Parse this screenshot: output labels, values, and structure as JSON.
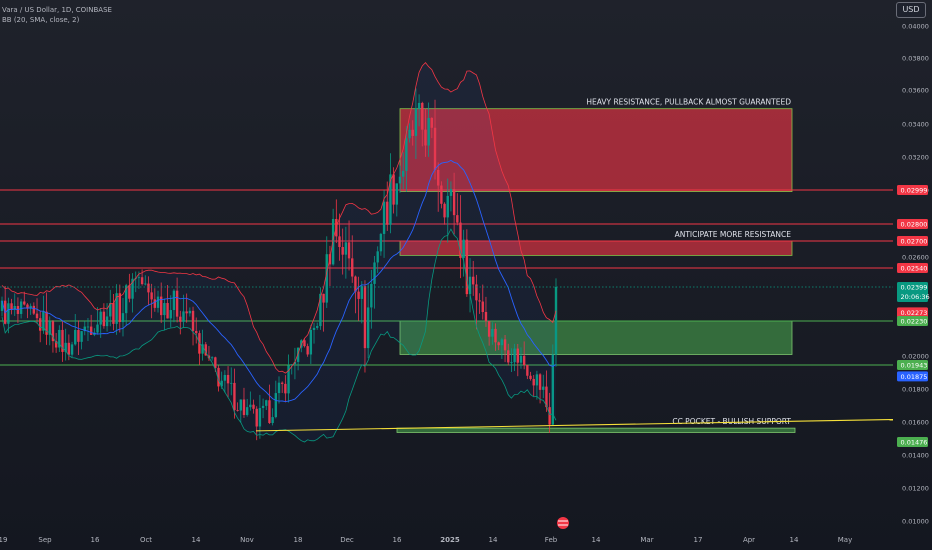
{
  "legend": {
    "symbol": "Vara / US Dollar, 1D, COINBASE",
    "indicator": "BB (20, SMA, close, 2)"
  },
  "currency_button": "USD",
  "chart_data": {
    "type": "candlestick",
    "y_axis": {
      "ylim": [
        0.0098,
        0.0406
      ],
      "ticks": [
        0.04,
        0.038,
        0.036,
        0.034,
        0.032,
        0.03,
        0.026,
        0.02,
        0.018,
        0.016,
        0.014,
        0.012,
        0.01
      ],
      "tick_labels": [
        "0.04000",
        "0.03800",
        "0.03600",
        "0.03400",
        "0.03200",
        "0.03000",
        "0.02600",
        "0.02000",
        "0.01800",
        "0.01600",
        "0.01400",
        "0.01200",
        "0.01000"
      ]
    },
    "x_axis": {
      "labels": [
        "19",
        "Sep",
        "16",
        "Oct",
        "14",
        "Nov",
        "18",
        "Dec",
        "16",
        "2025",
        "14",
        "Feb",
        "14",
        "Mar",
        "17",
        "Apr",
        "14",
        "May"
      ]
    },
    "price_labels": [
      {
        "value": 0.02999,
        "text": "0.02999",
        "color": "#f23645"
      },
      {
        "value": 0.028,
        "text": "0.02800",
        "color": "#f23645"
      },
      {
        "value": 0.027,
        "text": "0.02700",
        "color": "#f23645"
      },
      {
        "value": 0.0254,
        "text": "0.02540",
        "color": "#f23645"
      },
      {
        "value": 0.02399,
        "text": "0.02399",
        "subtext": "20:06:36",
        "color": "#089981"
      },
      {
        "value": 0.02273,
        "text": "0.02273",
        "color": "#f23645"
      },
      {
        "value": 0.0223,
        "text": "0.02230",
        "color": "#4caf50"
      },
      {
        "value": 0.01943,
        "text": "0.01943",
        "color": "#4caf50"
      },
      {
        "value": 0.01875,
        "text": "0.01875",
        "color": "#2962ff"
      },
      {
        "value": 0.01476,
        "text": "0.01476",
        "color": "#4caf50"
      }
    ],
    "horizontal_levels": [
      {
        "value": 0.02999,
        "color": "#f23645"
      },
      {
        "value": 0.028,
        "color": "#f23645"
      },
      {
        "value": 0.027,
        "color": "#f23645"
      },
      {
        "value": 0.0254,
        "color": "#f23645"
      },
      {
        "value": 0.0223,
        "color": "#4caf50"
      },
      {
        "value": 0.01943,
        "color": "#4caf50"
      }
    ],
    "zones": [
      {
        "kind": "resistance",
        "y_top": 0.0349,
        "y_bottom": 0.0299,
        "label": "HEAVY RESISTANCE, PULLBACK ALMOST GUARANTEED"
      },
      {
        "kind": "resistance",
        "y_top": 0.027,
        "y_bottom": 0.0261,
        "label": "ANTICIPATE MORE RESISTANCE"
      },
      {
        "kind": "support",
        "y_top": 0.0223,
        "y_bottom": 0.0201,
        "label": ""
      },
      {
        "kind": "support-thin",
        "y_top": 0.01562,
        "y_bottom": 0.01535,
        "label": "CC POCKET - BULLISH SUPPORT"
      }
    ],
    "trendline": {
      "from_value": 0.01545,
      "to_value": 0.01615,
      "color": "#f5e03a"
    },
    "last_price": 0.02399,
    "colors": {
      "up": "#089981",
      "down": "#f23645",
      "bb_basis": "#2962ff",
      "bb_upper": "#f23645",
      "bb_lower": "#089981"
    }
  }
}
